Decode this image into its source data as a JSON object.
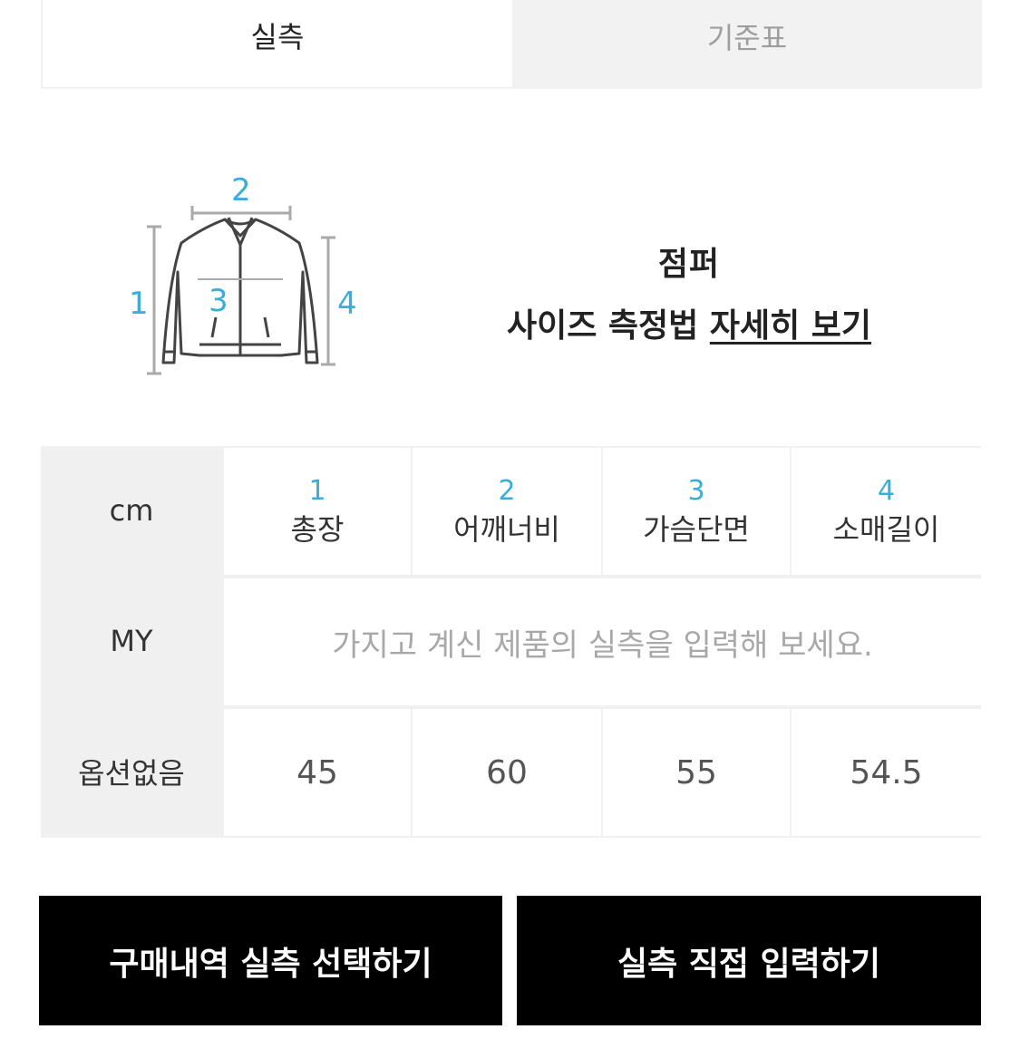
{
  "tabs": [
    {
      "label": "실측",
      "active": true
    },
    {
      "label": "기준표",
      "active": false
    }
  ],
  "diagram": {
    "icon": "jacket-measure-icon",
    "accent_color": "#3aaed8",
    "markers": [
      "1",
      "2",
      "3",
      "4"
    ]
  },
  "info": {
    "title": "점퍼",
    "guide_prefix": "사이즈 측정법",
    "guide_link": "자세히 보기"
  },
  "table": {
    "unit_label": "cm",
    "columns": [
      {
        "num": "1",
        "label": "총장"
      },
      {
        "num": "2",
        "label": "어깨너비"
      },
      {
        "num": "3",
        "label": "가슴단면"
      },
      {
        "num": "4",
        "label": "소매길이"
      }
    ],
    "my_row": {
      "label": "MY",
      "placeholder": "가지고 계신 제품의 실측을 입력해 보세요."
    },
    "option_row": {
      "label": "옵션없음",
      "values": [
        "45",
        "60",
        "55",
        "54.5"
      ]
    }
  },
  "buttons": {
    "purchase_history": "구매내역 실측 선택하기",
    "direct_input": "실측 직접 입력하기"
  }
}
